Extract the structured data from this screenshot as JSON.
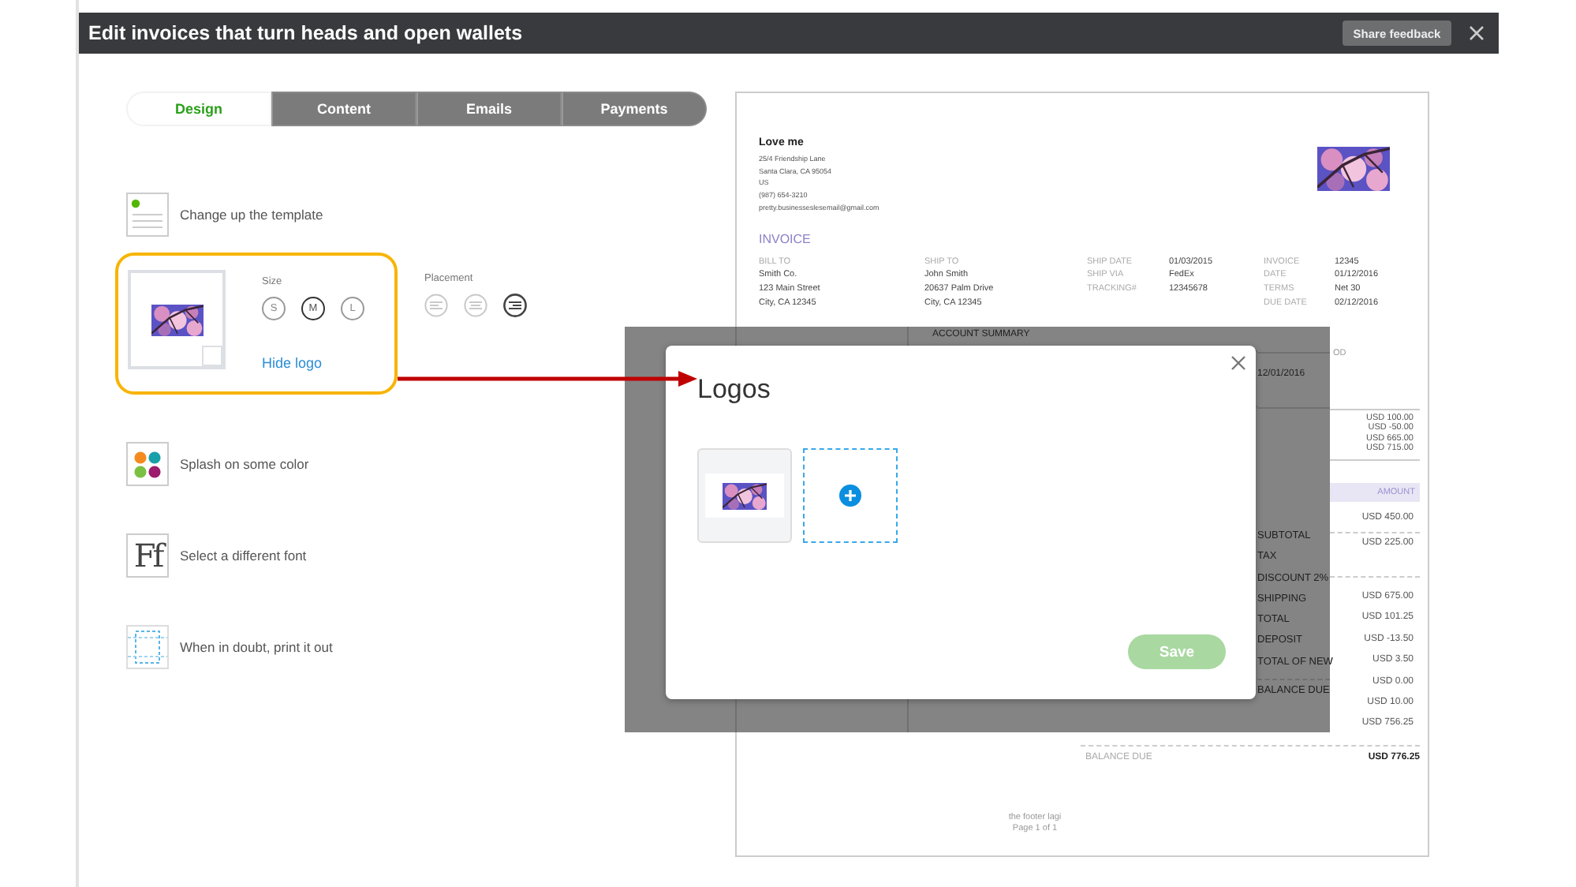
{
  "window": {
    "title": "Edit invoices that turn heads and open wallets",
    "feedback_button": "Share feedback"
  },
  "tabs": [
    {
      "label": "Design",
      "selected": true
    },
    {
      "label": "Content",
      "selected": false
    },
    {
      "label": "Emails",
      "selected": false
    },
    {
      "label": "Payments",
      "selected": false
    }
  ],
  "design_options": [
    {
      "kind": "template",
      "label": "Change up the template"
    },
    {
      "kind": "logo",
      "highlighted": true,
      "logo": {
        "kind": "picture"
      },
      "size_label": "Size",
      "sizes": [
        {
          "label": "S",
          "selected": false
        },
        {
          "label": "M",
          "selected": true
        },
        {
          "label": "L",
          "selected": false
        }
      ],
      "hide_link": "Hide logo",
      "placement_label": "Placement",
      "placements": [
        {
          "selected": false
        },
        {
          "selected": false
        },
        {
          "selected": true
        }
      ]
    },
    {
      "kind": "color",
      "label": "Splash on some color"
    },
    {
      "kind": "font",
      "icon_text": "Ff",
      "label": "Select a different font"
    },
    {
      "kind": "print",
      "label": "When in doubt, print it out"
    }
  ],
  "invoice": {
    "company": "Love me",
    "address": [
      "25/4 Friendship Lane",
      "Santa Clara, CA 95054",
      "US",
      "(987) 654-3210",
      "pretty.businesseslesemail@gmail.com"
    ],
    "logo": {
      "kind": "picture"
    },
    "heading": "INVOICE",
    "bill_to": {
      "label": "BILL TO",
      "lines": [
        "Smith Co.",
        "123 Main Street",
        "City, CA 12345"
      ]
    },
    "ship_to": {
      "label": "SHIP TO",
      "lines": [
        "John Smith",
        "20637 Palm Drive",
        "City, CA 12345"
      ]
    },
    "shipping_details": [
      {
        "label": "SHIP DATE",
        "value": "01/03/2015"
      },
      {
        "label": "SHIP VIA",
        "value": "FedEx"
      },
      {
        "label": "TRACKING#",
        "value": "12345678"
      }
    ],
    "invoice_details": [
      {
        "label": "INVOICE",
        "value": "12345"
      },
      {
        "label": "DATE",
        "value": "01/12/2016"
      },
      {
        "label": "TERMS",
        "value": "Net 30"
      },
      {
        "label": "DUE DATE",
        "value": "02/12/2016"
      }
    ],
    "account_summary_title": "ACCOUNT SUMMARY",
    "period_header": "OD",
    "period_date": "12/01/2016",
    "summary_amounts": [
      "USD 100.00",
      "USD -50.00",
      "USD 665.00",
      "USD 715.00"
    ],
    "amount_header": "AMOUNT",
    "line_amount": "USD 450.00",
    "totals_labels": [
      "SUBTOTAL",
      "TAX",
      "DISCOUNT 2%",
      "SHIPPING",
      "TOTAL",
      "DEPOSIT",
      "TOTAL OF NEW",
      "BALANCE DUE"
    ],
    "totals_amounts": [
      "USD 225.00",
      "USD 675.00",
      "USD 101.25",
      "USD -13.50",
      "USD 3.50",
      "USD 0.00",
      "USD 10.00",
      "USD 756.25"
    ],
    "balance_due": {
      "label": "BALANCE DUE",
      "value": "USD 776.25"
    },
    "footer": [
      "the footer lagi",
      "Page 1 of 1"
    ]
  },
  "modal": {
    "title": "Logos",
    "logos": [
      {
        "kind": "picture"
      }
    ],
    "save": {
      "label": "Save",
      "disabled": true
    }
  }
}
